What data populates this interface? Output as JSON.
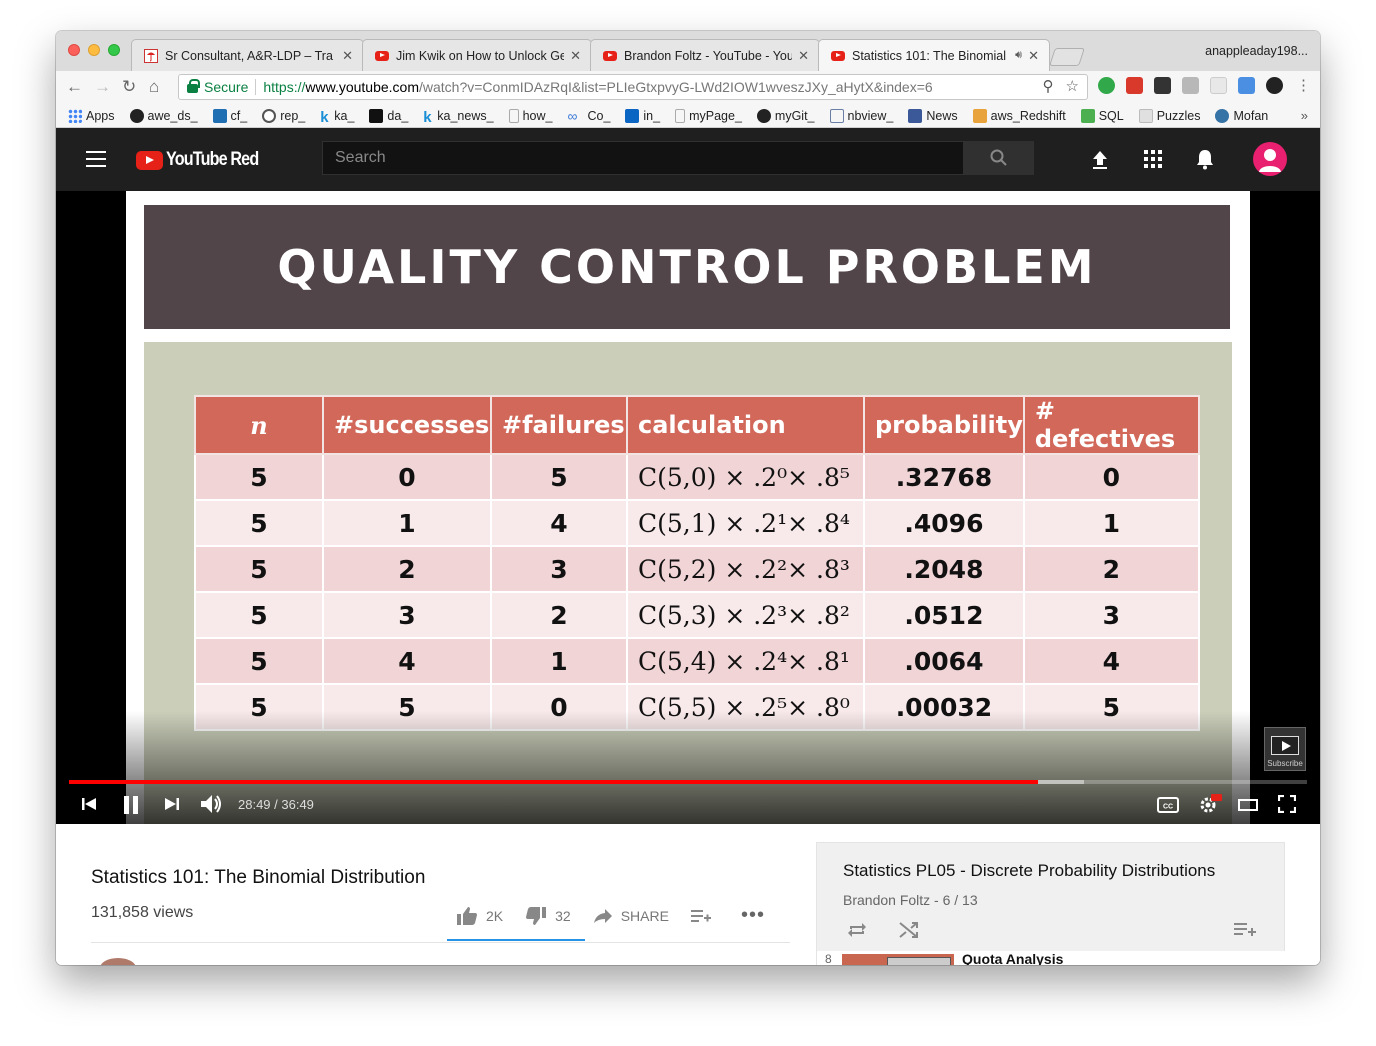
{
  "browser": {
    "tabs": [
      {
        "label": "Sr Consultant, A&R-LDP – Tra",
        "icon": "umbrella-icon"
      },
      {
        "label": "Jim Kwik on How to Unlock Ge",
        "icon": "youtube-icon"
      },
      {
        "label": "Brandon Foltz - YouTube - You",
        "icon": "youtube-icon"
      },
      {
        "label": "Statistics 101: The Binomial",
        "icon": "youtube-icon",
        "active": true
      }
    ],
    "profile": "anappleaday198...",
    "omnibox": {
      "secure_label": "Secure",
      "url_scheme": "https://",
      "url_host": "www.youtube.com",
      "url_rest": "/watch?v=ConmIDAzRqI&list=PLIeGtxpvyG-LWd2IOW1wveszJXy_aHytX&index=6"
    },
    "bookmarks": [
      {
        "label": "Apps",
        "color": "#4285f4"
      },
      {
        "label": "awe_ds_",
        "color": "#222222"
      },
      {
        "label": "cf_",
        "color": "#1f6fb2"
      },
      {
        "label": "rep_",
        "color": "#555555"
      },
      {
        "label": "ka_",
        "color": "#1a8fd6"
      },
      {
        "label": "da_",
        "color": "#111111"
      },
      {
        "label": "ka_news_",
        "color": "#1a8fd6"
      },
      {
        "label": "how_",
        "color": "#bbbbbb"
      },
      {
        "label": "Co_",
        "color": "#3b7bd8"
      },
      {
        "label": "in_",
        "color": "#0a66c2"
      },
      {
        "label": "myPage_",
        "color": "#bbbbbb"
      },
      {
        "label": "myGit_",
        "color": "#222222"
      },
      {
        "label": "nbview_",
        "color": "#6a7fa5"
      },
      {
        "label": "News",
        "color": "#3b5998"
      },
      {
        "label": "aws_Redshift",
        "color": "#e8a33d"
      },
      {
        "label": "SQL",
        "color": "#4caf50"
      },
      {
        "label": "Puzzles",
        "color": "#cfcfcf"
      },
      {
        "label": "Mofan",
        "color": "#3572a5"
      }
    ]
  },
  "youtube": {
    "logo_text": "YouTube Red",
    "search_placeholder": "Search"
  },
  "slide": {
    "title": "QUALITY CONTROL PROBLEM",
    "headers": [
      "n",
      "#successes",
      "#failures",
      "calculation",
      "probability",
      "# defectives"
    ],
    "rows": [
      {
        "n": "5",
        "s": "0",
        "f": "5",
        "calc": "C(5,0) × .2⁰× .8⁵",
        "p": ".32768",
        "d": "0"
      },
      {
        "n": "5",
        "s": "1",
        "f": "4",
        "calc": "C(5,1) × .2¹× .8⁴",
        "p": ".4096",
        "d": "1"
      },
      {
        "n": "5",
        "s": "2",
        "f": "3",
        "calc": "C(5,2) × .2²× .8³",
        "p": ".2048",
        "d": "2"
      },
      {
        "n": "5",
        "s": "3",
        "f": "2",
        "calc": "C(5,3) × .2³× .8²",
        "p": ".0512",
        "d": "3"
      },
      {
        "n": "5",
        "s": "4",
        "f": "1",
        "calc": "C(5,4) × .2⁴× .8¹",
        "p": ".0064",
        "d": "4"
      },
      {
        "n": "5",
        "s": "5",
        "f": "0",
        "calc": "C(5,5) × .2⁵× .8⁰",
        "p": ".00032",
        "d": "5"
      }
    ]
  },
  "player": {
    "time": "28:49 / 36:49",
    "progress_fraction": 0.783,
    "buffered_fraction": 0.82,
    "subscribe_label": "Subscribe"
  },
  "video_info": {
    "title": "Statistics 101: The Binomial Distribution",
    "views": "131,858 views",
    "likes": "2K",
    "dislikes": "32",
    "share_label": "SHARE"
  },
  "playlist": {
    "title": "Statistics PL05 - Discrete Probability Distributions",
    "subtitle": "Brandon Foltz - 6 / 13",
    "next_item_number": "8",
    "next_item_title": "Quota Analysis"
  }
}
